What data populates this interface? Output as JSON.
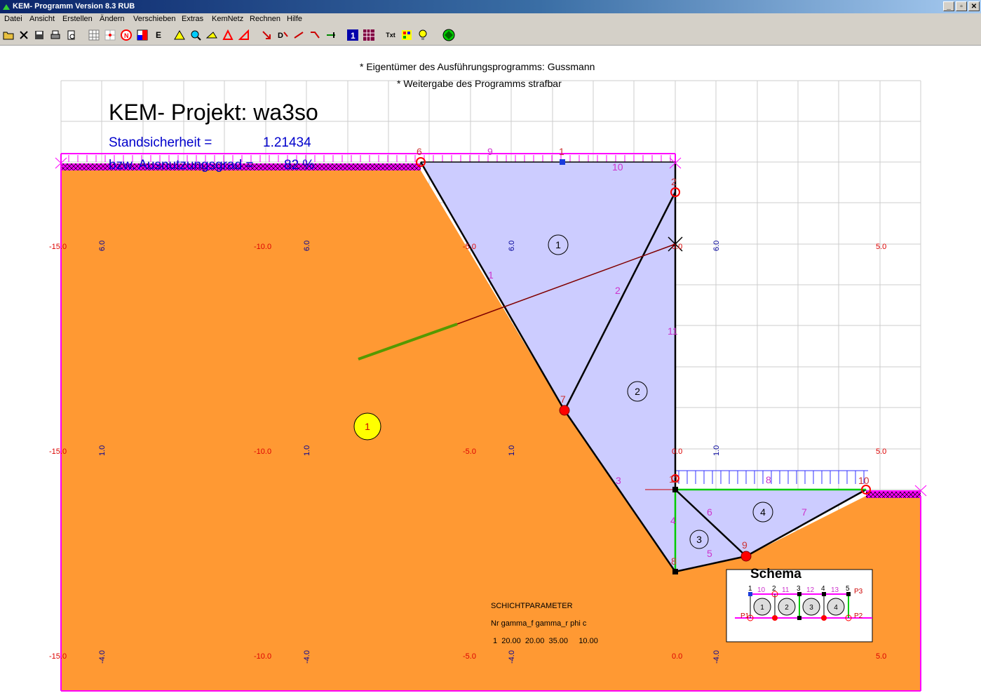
{
  "window": {
    "title": "KEM- Programm Version 8.3 RUB",
    "btn_min": "_",
    "btn_max": "▫",
    "btn_close": "✕"
  },
  "menu": [
    "Datei",
    "Ansicht",
    "Erstellen",
    "Ändern",
    "Verschieben",
    "Extras",
    "KemNetz",
    "Rechnen",
    "Hilfe"
  ],
  "toolbar": {
    "e_label": "E",
    "text_label": "Txt"
  },
  "owner": {
    "line1": "* Eigentümer des Ausführungsprogramms: Gussmann",
    "line2": "* Weitergabe des Programms strafbar"
  },
  "project": {
    "title": "KEM- Projekt: wa3so",
    "safety_label": "Standsicherheit =",
    "safety_value": "1.21434",
    "util_label": "bzw. Ausnutzungsgrad =",
    "util_value": "82 %"
  },
  "axis_labels": {
    "row1": {
      "x_m15": "-15.0",
      "x_m10": "-10.0",
      "x_m5": "-5.0",
      "x_0": "0.0",
      "x_5": "5.0",
      "v6a": "6.0",
      "v6b": "6.0",
      "v6c": "6.0",
      "v6d": "6.0"
    },
    "row2": {
      "x_m15": "-15.0",
      "x_m10": "-10.0",
      "x_m5": "-5.0",
      "x_0": "0.0",
      "x_5": "5.0",
      "v1a": "1.0",
      "v1b": "1.0",
      "v1c": "1.0",
      "v1d": "1.0"
    },
    "row3": {
      "x_m15": "-15.0",
      "x_m10": "-10.0",
      "x_m5": "-5.0",
      "x_0": "0.0",
      "x_5": "5.0",
      "v4a": "-4.0",
      "v4b": "-4.0",
      "v4c": "-4.0",
      "v4d": "-4.0"
    }
  },
  "node_labels": {
    "n1": "1",
    "n2": "2",
    "n6": "6",
    "n7": "7",
    "n8": "8",
    "n9": "9",
    "n10": "10",
    "n11": "11"
  },
  "edge_labels": {
    "e1": "1",
    "e2": "2",
    "e3": "3",
    "e4": "4",
    "e5": "5",
    "e6": "6",
    "e7": "7",
    "e8": "8",
    "e9": "9",
    "e10": "10",
    "e11": "11"
  },
  "body_labels": {
    "b1": "1",
    "b2": "2",
    "b3": "3",
    "b4": "4"
  },
  "layer_label": "1",
  "schema": {
    "title": "Schema",
    "top": [
      "1",
      "2",
      "3",
      "4",
      "5"
    ],
    "between": [
      "10",
      "11",
      "12",
      "13"
    ],
    "bodies": [
      "1",
      "2",
      "3",
      "4"
    ],
    "p1": "P1",
    "p2": "P2",
    "p3": "P3"
  },
  "params": {
    "title": "SCHICHTPARAMETER",
    "header": "Nr gamma_f gamma_r phi c",
    "row": "1  20.00  20.00  35.00     10.00"
  },
  "colors": {
    "soil": "#ff9933",
    "wedge": "#ccccff",
    "load": "#ff00ff",
    "grid": "#cccccc",
    "axis_red": "#dd0000",
    "axis_blue": "#000099",
    "node_red": "#ff0000",
    "green_line": "#00cc00"
  }
}
